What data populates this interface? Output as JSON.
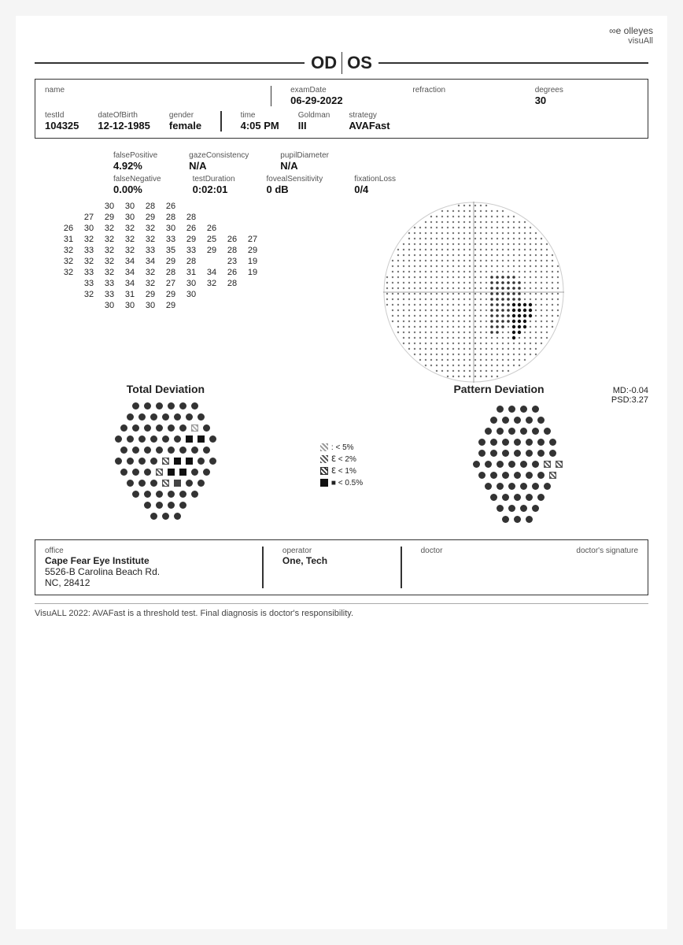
{
  "brand": {
    "logo": "∞e olleyes",
    "product": "visuAll"
  },
  "header": {
    "od": "OD",
    "os": "OS"
  },
  "patient": {
    "name_label": "name",
    "name_value": "",
    "examDate_label": "examDate",
    "examDate_value": "06-29-2022",
    "refraction_label": "refraction",
    "refraction_value": "",
    "degrees_label": "degrees",
    "degrees_value": "30",
    "testId_label": "testId",
    "testId_value": "104325",
    "dob_label": "dateOfBirth",
    "dob_value": "12-12-1985",
    "gender_label": "gender",
    "gender_value": "female",
    "time_label": "time",
    "time_value": "4:05 PM",
    "goldman_label": "Goldman",
    "goldman_value": "III",
    "strategy_label": "strategy",
    "strategy_value": "AVAFast"
  },
  "stats": {
    "falsePositive_label": "falsePositive",
    "falsePositive_value": "4.92%",
    "gazeConsistency_label": "gazeConsistency",
    "gazeConsistency_value": "N/A",
    "pupilDiameter_label": "pupilDiameter",
    "pupilDiameter_value": "N/A",
    "falseNegative_label": "falseNegative",
    "falseNegative_value": "0.00%",
    "testDuration_label": "testDuration",
    "testDuration_value": "0:02:01",
    "fovealSensitivity_label": "fovealSensitivity",
    "fovealSensitivity_value": "0 dB",
    "fixationLoss_label": "fixationLoss",
    "fixationLoss_value": "0/4"
  },
  "grid": {
    "rows": [
      [
        null,
        null,
        30,
        30,
        28,
        26,
        null,
        null,
        null,
        null
      ],
      [
        null,
        27,
        29,
        30,
        29,
        28,
        28,
        null,
        null,
        null
      ],
      [
        26,
        30,
        32,
        32,
        32,
        30,
        26,
        26,
        null,
        null
      ],
      [
        31,
        32,
        32,
        32,
        32,
        33,
        29,
        25,
        26,
        27
      ],
      [
        32,
        33,
        32,
        32,
        33,
        35,
        33,
        29,
        28,
        29
      ],
      [
        32,
        32,
        32,
        34,
        34,
        29,
        28,
        null,
        23,
        19
      ],
      [
        32,
        33,
        32,
        34,
        32,
        28,
        31,
        34,
        26,
        19
      ],
      [
        null,
        33,
        33,
        34,
        32,
        27,
        30,
        32,
        28,
        null
      ],
      [
        null,
        32,
        33,
        31,
        29,
        29,
        30,
        null,
        null,
        null
      ],
      [
        null,
        null,
        30,
        30,
        30,
        29,
        null,
        null,
        null,
        null
      ]
    ]
  },
  "deviation": {
    "total_title": "Total Deviation",
    "pattern_title": "Pattern Deviation",
    "md_label": "MD:",
    "md_value": "-0.04",
    "psd_label": "PSD:",
    "psd_value": "3.27"
  },
  "legend": {
    "items": [
      {
        "symbol": "dither",
        "text": "< 5%"
      },
      {
        "symbol": "gray",
        "text": "< 2%"
      },
      {
        "symbol": "dark",
        "text": "< 1%"
      },
      {
        "symbol": "black",
        "text": "< 0.5%"
      }
    ]
  },
  "footer": {
    "office_label": "office",
    "office_name": "Cape Fear Eye Institute",
    "office_addr1": "5526-B Carolina Beach Rd.",
    "office_addr2": "NC, 28412",
    "operator_label": "operator",
    "operator_value": "One, Tech",
    "doctor_label": "doctor",
    "doctor_value": "",
    "signature_label": "doctor's signature"
  },
  "disclaimer": "VisuALL 2022: AVAFast is a threshold test. Final diagnosis is doctor's responsibility."
}
